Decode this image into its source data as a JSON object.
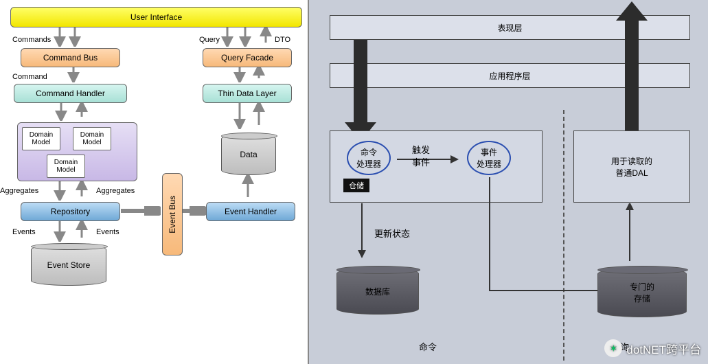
{
  "left": {
    "user_interface": "User Interface",
    "commands_arrow": "Commands",
    "command_bus": "Command Bus",
    "command_arrow": "Command",
    "command_handler": "Command Handler",
    "domain_model": "Domain\nModel",
    "aggregates_left": "Aggregates",
    "aggregates_right": "Aggregates",
    "repository": "Repository",
    "events_left": "Events",
    "events_right": "Events",
    "event_store": "Event Store",
    "event_bus": "Event Bus",
    "event_handler": "Event Handler",
    "thin_data_layer": "Thin Data Layer",
    "data": "Data",
    "query_facade": "Query Facade",
    "query_arrow": "Query",
    "dto_arrow": "DTO"
  },
  "right": {
    "presentation_layer": "表现层",
    "application_layer": "应用程序层",
    "cmd_handler": "命令\n处理器",
    "repo_tag": "仓储",
    "trigger": "触发",
    "event_label": "事件",
    "event_handler": "事件\n处理器",
    "read_dal": "用于读取的\n普通DAL",
    "update_state": "更新状态",
    "database": "数据库",
    "dedicated_store": "专门的\n存储",
    "command_bottom": "命令",
    "query_bottom": "查询",
    "watermark": "dotNET跨平台"
  }
}
